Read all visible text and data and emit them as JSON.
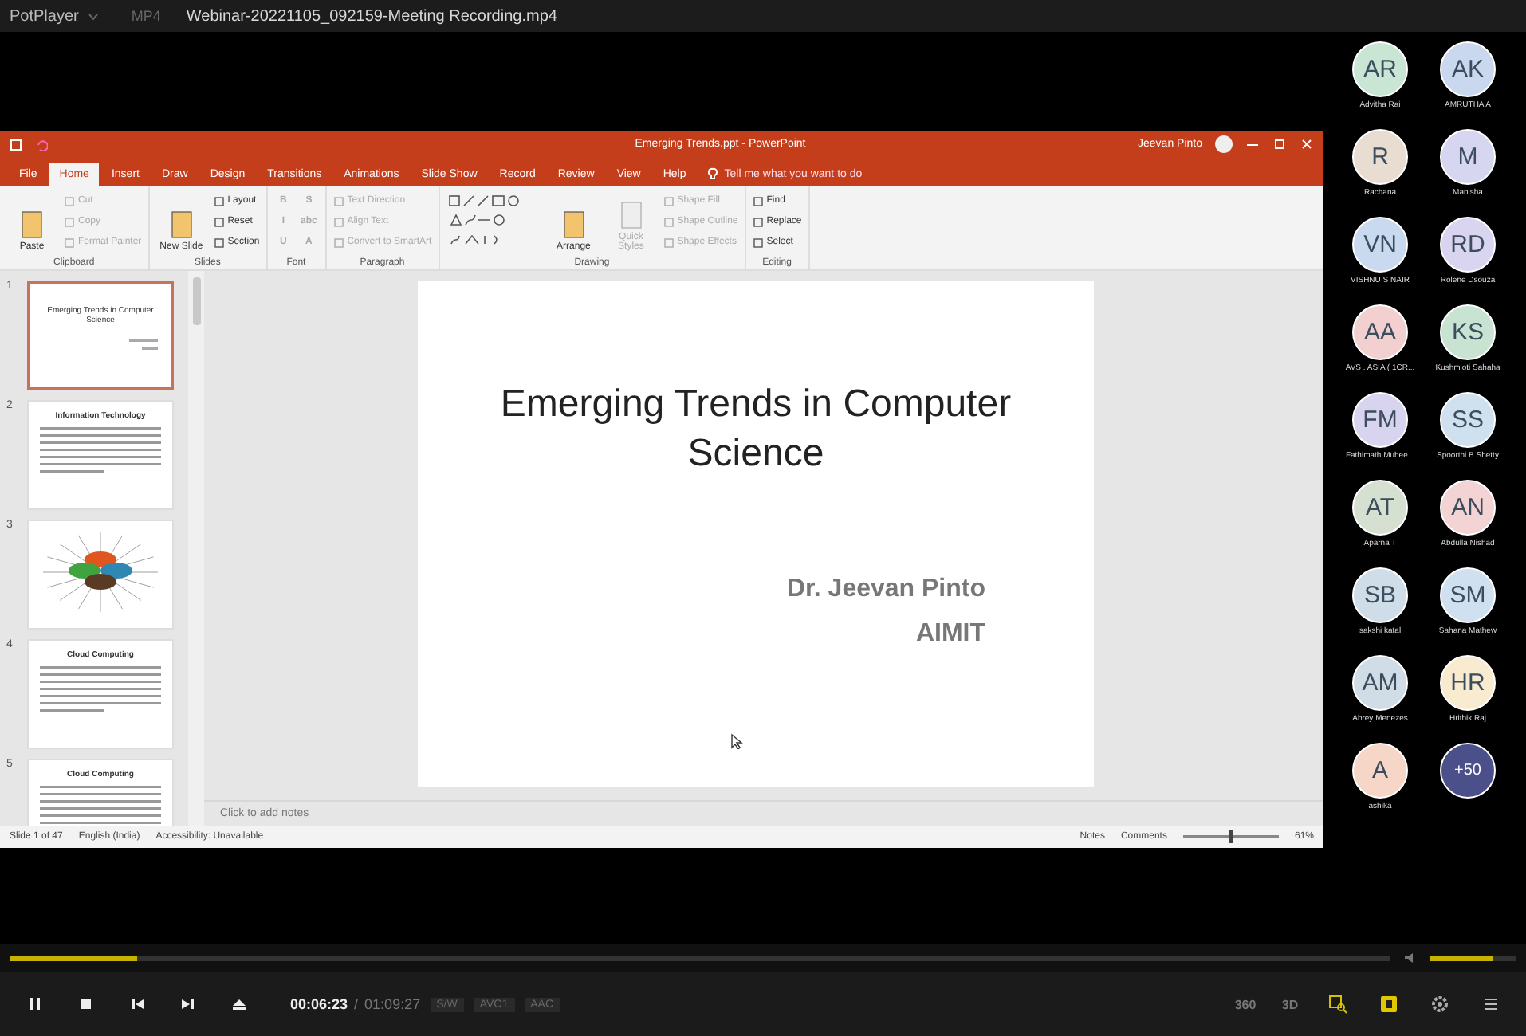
{
  "player": {
    "app_name": "PotPlayer",
    "format": "MP4",
    "file_title": "Webinar-20221105_092159-Meeting Recording.mp4"
  },
  "powerpoint": {
    "title": "Emerging Trends.ppt  -  PowerPoint",
    "user": "Jeevan Pinto",
    "tabs": [
      {
        "label": "File",
        "selected": false
      },
      {
        "label": "Home",
        "selected": true
      },
      {
        "label": "Insert",
        "selected": false
      },
      {
        "label": "Draw",
        "selected": false
      },
      {
        "label": "Design",
        "selected": false
      },
      {
        "label": "Transitions",
        "selected": false
      },
      {
        "label": "Animations",
        "selected": false
      },
      {
        "label": "Slide Show",
        "selected": false
      },
      {
        "label": "Record",
        "selected": false
      },
      {
        "label": "Review",
        "selected": false
      },
      {
        "label": "View",
        "selected": false
      },
      {
        "label": "Help",
        "selected": false
      }
    ],
    "tell_me": "Tell me what you want to do",
    "ribbon_groups": [
      {
        "label": "Clipboard",
        "items": [
          {
            "kind": "large",
            "label": "Paste",
            "disabled": false
          },
          {
            "kind": "small",
            "label": "Cut",
            "disabled": true
          },
          {
            "kind": "small",
            "label": "Copy",
            "disabled": true
          },
          {
            "kind": "small",
            "label": "Format Painter",
            "disabled": true
          }
        ]
      },
      {
        "label": "Slides",
        "items": [
          {
            "kind": "large",
            "label": "New Slide",
            "disabled": false
          },
          {
            "kind": "small",
            "label": "Layout",
            "disabled": false
          },
          {
            "kind": "small",
            "label": "Reset",
            "disabled": false
          },
          {
            "kind": "small",
            "label": "Section",
            "disabled": false
          }
        ]
      },
      {
        "label": "Font",
        "items": [
          {
            "kind": "glyph",
            "label": "B",
            "disabled": true
          },
          {
            "kind": "glyph",
            "label": "I",
            "disabled": true
          },
          {
            "kind": "glyph",
            "label": "U",
            "disabled": true
          },
          {
            "kind": "glyph",
            "label": "S",
            "disabled": true
          },
          {
            "kind": "glyph",
            "label": "abc",
            "disabled": true
          },
          {
            "kind": "glyph",
            "label": "A",
            "disabled": true
          }
        ]
      },
      {
        "label": "Paragraph",
        "items": [
          {
            "kind": "small",
            "label": "Text Direction",
            "disabled": true
          },
          {
            "kind": "small",
            "label": "Align Text",
            "disabled": true
          },
          {
            "kind": "small",
            "label": "Convert to SmartArt",
            "disabled": true
          }
        ]
      },
      {
        "label": "Drawing",
        "items": [
          {
            "kind": "shapes",
            "disabled": false
          },
          {
            "kind": "large",
            "label": "Arrange",
            "disabled": false
          },
          {
            "kind": "large",
            "label": "Quick Styles",
            "disabled": true
          },
          {
            "kind": "small",
            "label": "Shape Fill",
            "disabled": true
          },
          {
            "kind": "small",
            "label": "Shape Outline",
            "disabled": true
          },
          {
            "kind": "small",
            "label": "Shape Effects",
            "disabled": true
          }
        ]
      },
      {
        "label": "Editing",
        "items": [
          {
            "kind": "small",
            "label": "Find",
            "disabled": false
          },
          {
            "kind": "small",
            "label": "Replace",
            "disabled": false
          },
          {
            "kind": "small",
            "label": "Select",
            "disabled": false
          }
        ]
      }
    ],
    "slides": [
      {
        "number": "1",
        "kind": "title",
        "selected": true,
        "title": "Emerging Trends in Computer Science"
      },
      {
        "number": "2",
        "kind": "bullets",
        "selected": false,
        "title": "Information Technology"
      },
      {
        "number": "3",
        "kind": "diagram",
        "selected": false
      },
      {
        "number": "4",
        "kind": "bullets",
        "selected": false,
        "title": "Cloud Computing"
      },
      {
        "number": "5",
        "kind": "bullets",
        "selected": false,
        "title": "Cloud Computing"
      }
    ],
    "current_slide": {
      "title": "Emerging Trends in Computer Science",
      "author": "Dr. Jeevan Pinto",
      "institution": "AIMIT"
    },
    "notes_placeholder": "Click to add notes",
    "status_bar": {
      "slide": "Slide 1 of 47",
      "language": "English (India)",
      "accessibility": "Accessibility: Unavailable",
      "notes": "Notes",
      "comments": "Comments",
      "zoom": "61%",
      "zoom_slider": {
        "level": 0.5
      }
    }
  },
  "participants": [
    {
      "initials": "AR",
      "name": "Advitha Rai",
      "color": "#c8e6d3"
    },
    {
      "initials": "AK",
      "name": "AMRUTHA A",
      "color": "#c9d8ee"
    },
    {
      "initials": "R",
      "name": "Rachana",
      "color": "#e9ddd2"
    },
    {
      "initials": "M",
      "name": "Manisha",
      "color": "#d6d6f0"
    },
    {
      "initials": "VN",
      "name": "VISHNU S NAIR",
      "color": "#c8d9f0"
    },
    {
      "initials": "RD",
      "name": "Rolene Dsouza",
      "color": "#d9d4ef"
    },
    {
      "initials": "AA",
      "name": "AVS . ASIA ( 1CR...",
      "color": "#f3d0d0"
    },
    {
      "initials": "KS",
      "name": "Kushmjoti Sahaha",
      "color": "#c9e3d2"
    },
    {
      "initials": "FM",
      "name": "Fathimath Mubee...",
      "color": "#d8d4f0"
    },
    {
      "initials": "SS",
      "name": "Spoorthi B Shetty",
      "color": "#cfe0ee"
    },
    {
      "initials": "AT",
      "name": "Aparna T",
      "color": "#d6e0d0"
    },
    {
      "initials": "AN",
      "name": "Abdulla Nishad",
      "color": "#f3d3d3"
    },
    {
      "initials": "SB",
      "name": "sakshi katal",
      "color": "#cfdde9"
    },
    {
      "initials": "SM",
      "name": "Sahana Mathew",
      "color": "#cfe0f0"
    },
    {
      "initials": "AM",
      "name": "Abrey Menezes",
      "color": "#d0dde6"
    },
    {
      "initials": "HR",
      "name": "Hrithik Raj",
      "color": "#f8ebcf"
    },
    {
      "initials": "A",
      "name": "ashika",
      "color": "#f6d6c6"
    },
    {
      "initials": "+50",
      "kind": "more",
      "color": "#4b4f8a"
    }
  ],
  "playback": {
    "level": 0.092,
    "paused": false,
    "elapsed": "00:06:23",
    "separator": "/",
    "duration": "01:09:27",
    "badges": [
      "S/W",
      "AVC1",
      "AAC"
    ],
    "volume": {
      "level": 0.72
    },
    "toggles": [
      "360",
      "3D"
    ]
  }
}
